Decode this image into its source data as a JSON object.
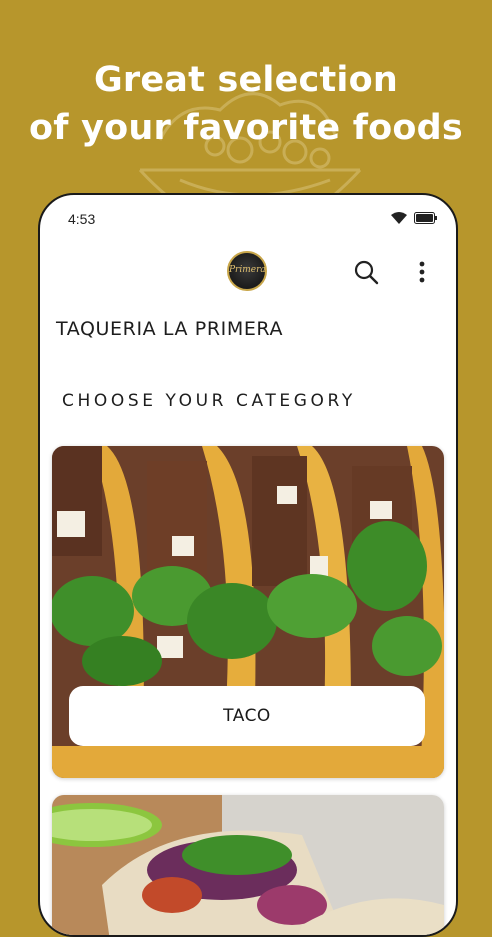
{
  "promo": {
    "headline_line1": "Great selection",
    "headline_line2": "of your favorite foods"
  },
  "status_bar": {
    "time": "4:53"
  },
  "header": {
    "logo_text": "Primera",
    "search_icon": "search-icon",
    "menu_icon": "more-vert-icon"
  },
  "restaurant_name": "TAQUERIA LA PRIMERA",
  "section_title": "CHOOSE YOUR CATEGORY",
  "categories": [
    {
      "label": "TACO"
    }
  ],
  "colors": {
    "background": "#b7962c",
    "card_button": "#ffffff",
    "text": "#1d1d1d"
  }
}
